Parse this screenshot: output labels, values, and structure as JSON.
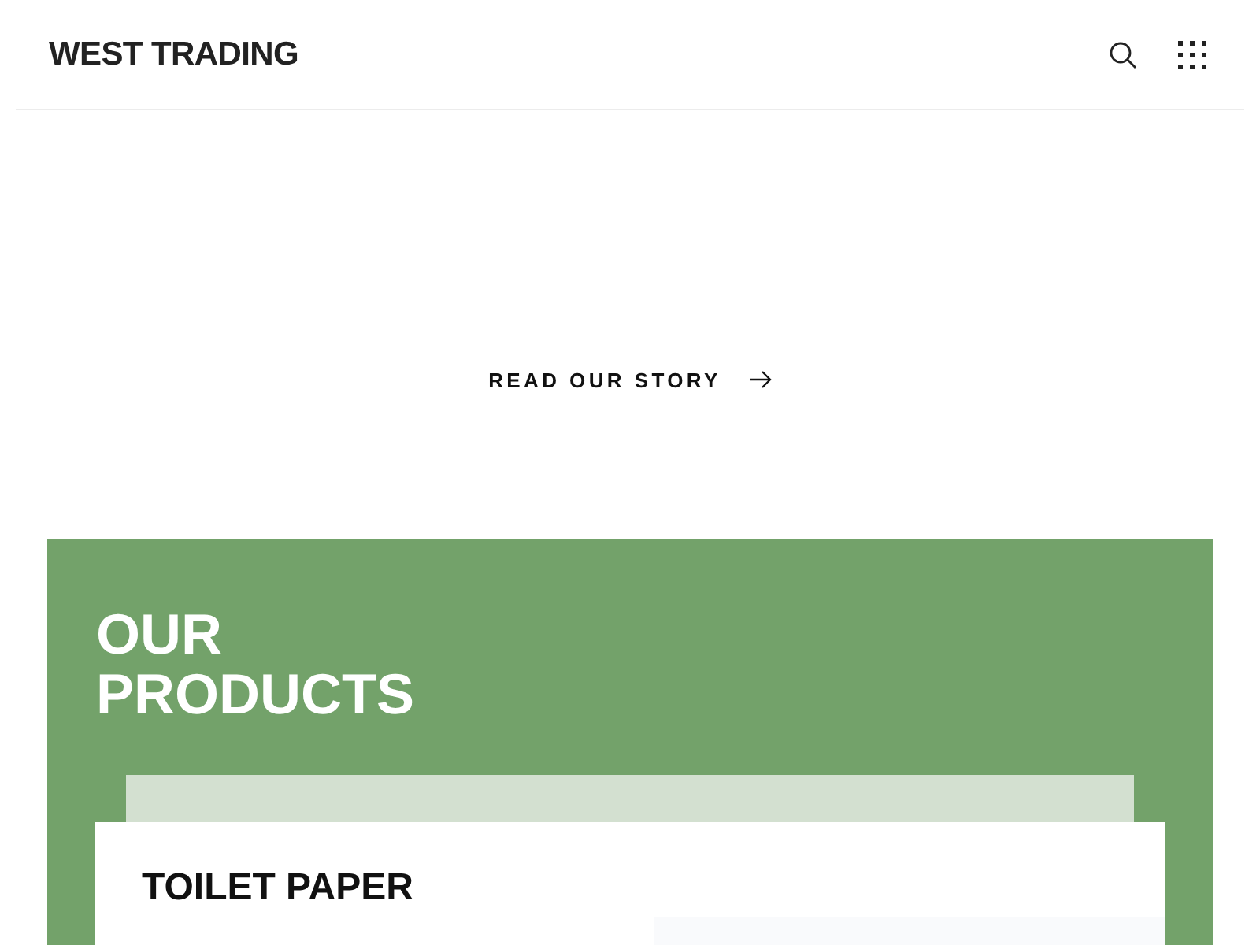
{
  "header": {
    "logo": "WEST TRADING"
  },
  "story_link": {
    "label": "READ OUR STORY"
  },
  "products": {
    "heading_lines": [
      "OUR",
      "PRODUCTS"
    ],
    "items": [
      {
        "title": "TOILET PAPER"
      }
    ]
  }
}
